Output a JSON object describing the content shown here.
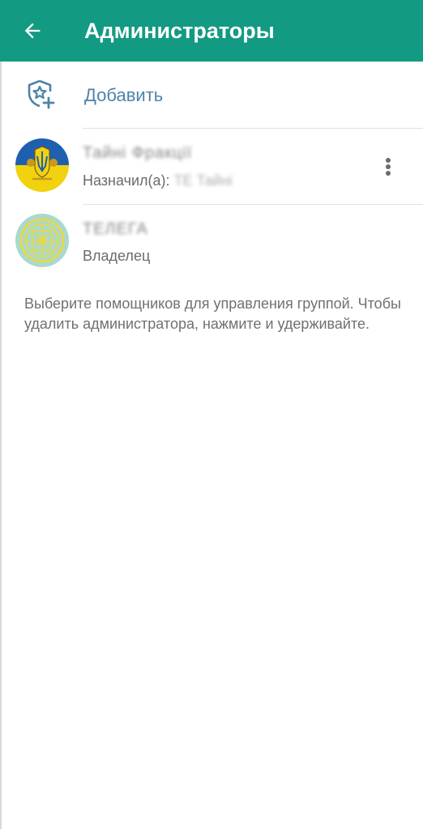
{
  "header": {
    "title": "Администраторы",
    "back_icon": "arrow-left-icon",
    "background": "#139a82"
  },
  "add_action": {
    "label": "Добавить",
    "icon": "shield-star-plus-icon"
  },
  "admins": [
    {
      "name": "Тайні Фракції",
      "subtitle_prefix": "Назначил(а): ",
      "subtitle_value": "ТЕ Тайні",
      "menu_icon": "more-vert-icon",
      "avatar": "ukraine-emblem"
    },
    {
      "name": "ТЕЛЕГА",
      "subtitle": "Владелец",
      "avatar": "ornament-emblem"
    }
  ],
  "hint": "Выберите помощников для управления группой. Чтобы удалить администратора, нажмите и удерживайте."
}
